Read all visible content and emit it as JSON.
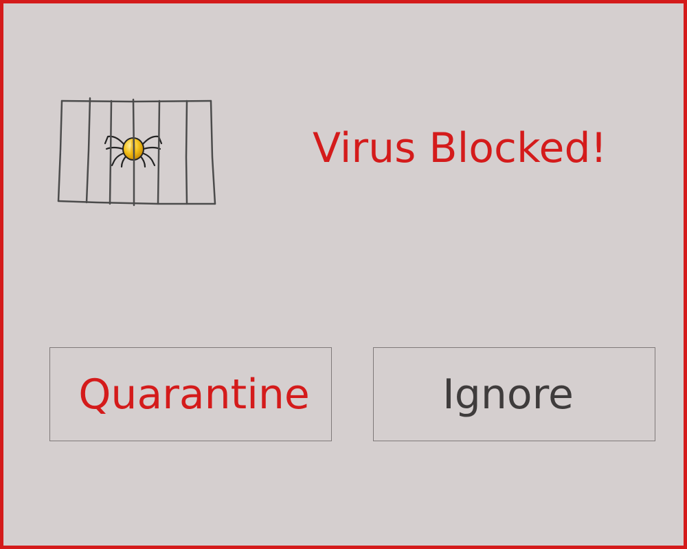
{
  "dialog": {
    "title": "Virus Blocked!",
    "icon": "caged-bug-icon",
    "accent_color": "#d41b1b",
    "background_color": "#d5cfcf"
  },
  "buttons": {
    "quarantine_label": "Quarantine",
    "ignore_label": "Ignore"
  }
}
